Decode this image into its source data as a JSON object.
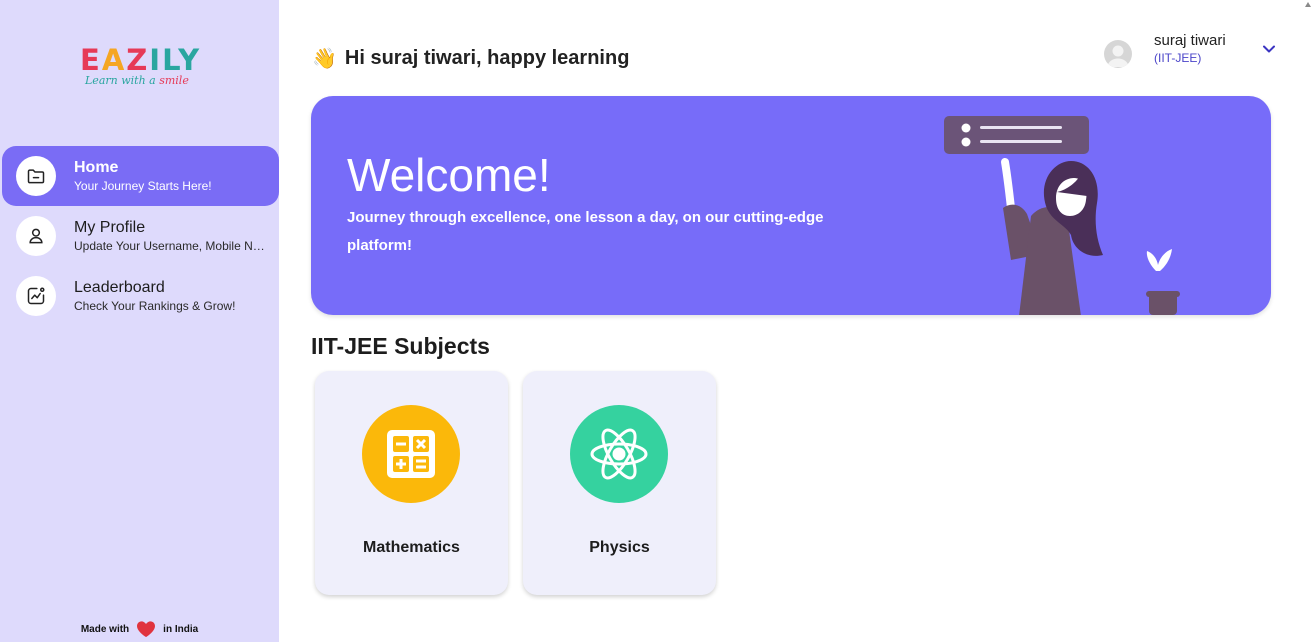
{
  "brand": {
    "logo_letters": [
      "E",
      "A",
      "Z",
      "I",
      "L",
      "Y"
    ],
    "tagline_prefix": "Learn with a ",
    "tagline_accent": "smile"
  },
  "sidebar": {
    "items": [
      {
        "title": "Home",
        "subtitle": "Your Journey Starts Here!",
        "icon": "folder-icon",
        "active": true
      },
      {
        "title": "My Profile",
        "subtitle": "Update Your Username, Mobile Number",
        "icon": "user-icon",
        "active": false
      },
      {
        "title": "Leaderboard",
        "subtitle": "Check Your Rankings & Grow!",
        "icon": "chart-icon",
        "active": false
      }
    ],
    "footer_prefix": "Made with",
    "footer_suffix": "in India"
  },
  "header": {
    "wave_emoji": "👋",
    "greeting": "Hi suraj tiwari, happy learning",
    "user_name": "suraj tiwari",
    "user_role": "(IIT-JEE)"
  },
  "banner": {
    "title": "Welcome!",
    "text": "Journey through excellence, one lesson a day, on our cutting-edge platform!"
  },
  "subjects": {
    "heading": "IIT-JEE Subjects",
    "items": [
      {
        "label": "Mathematics",
        "color": "#fbb80a",
        "icon": "calculator-icon"
      },
      {
        "label": "Physics",
        "color": "#35d29f",
        "icon": "atom-icon"
      }
    ]
  },
  "colors": {
    "sidebar_bg": "#dedafc",
    "accent": "#7a6cf5",
    "banner_bg": "#776cf9",
    "card_bg": "#efeffb"
  }
}
